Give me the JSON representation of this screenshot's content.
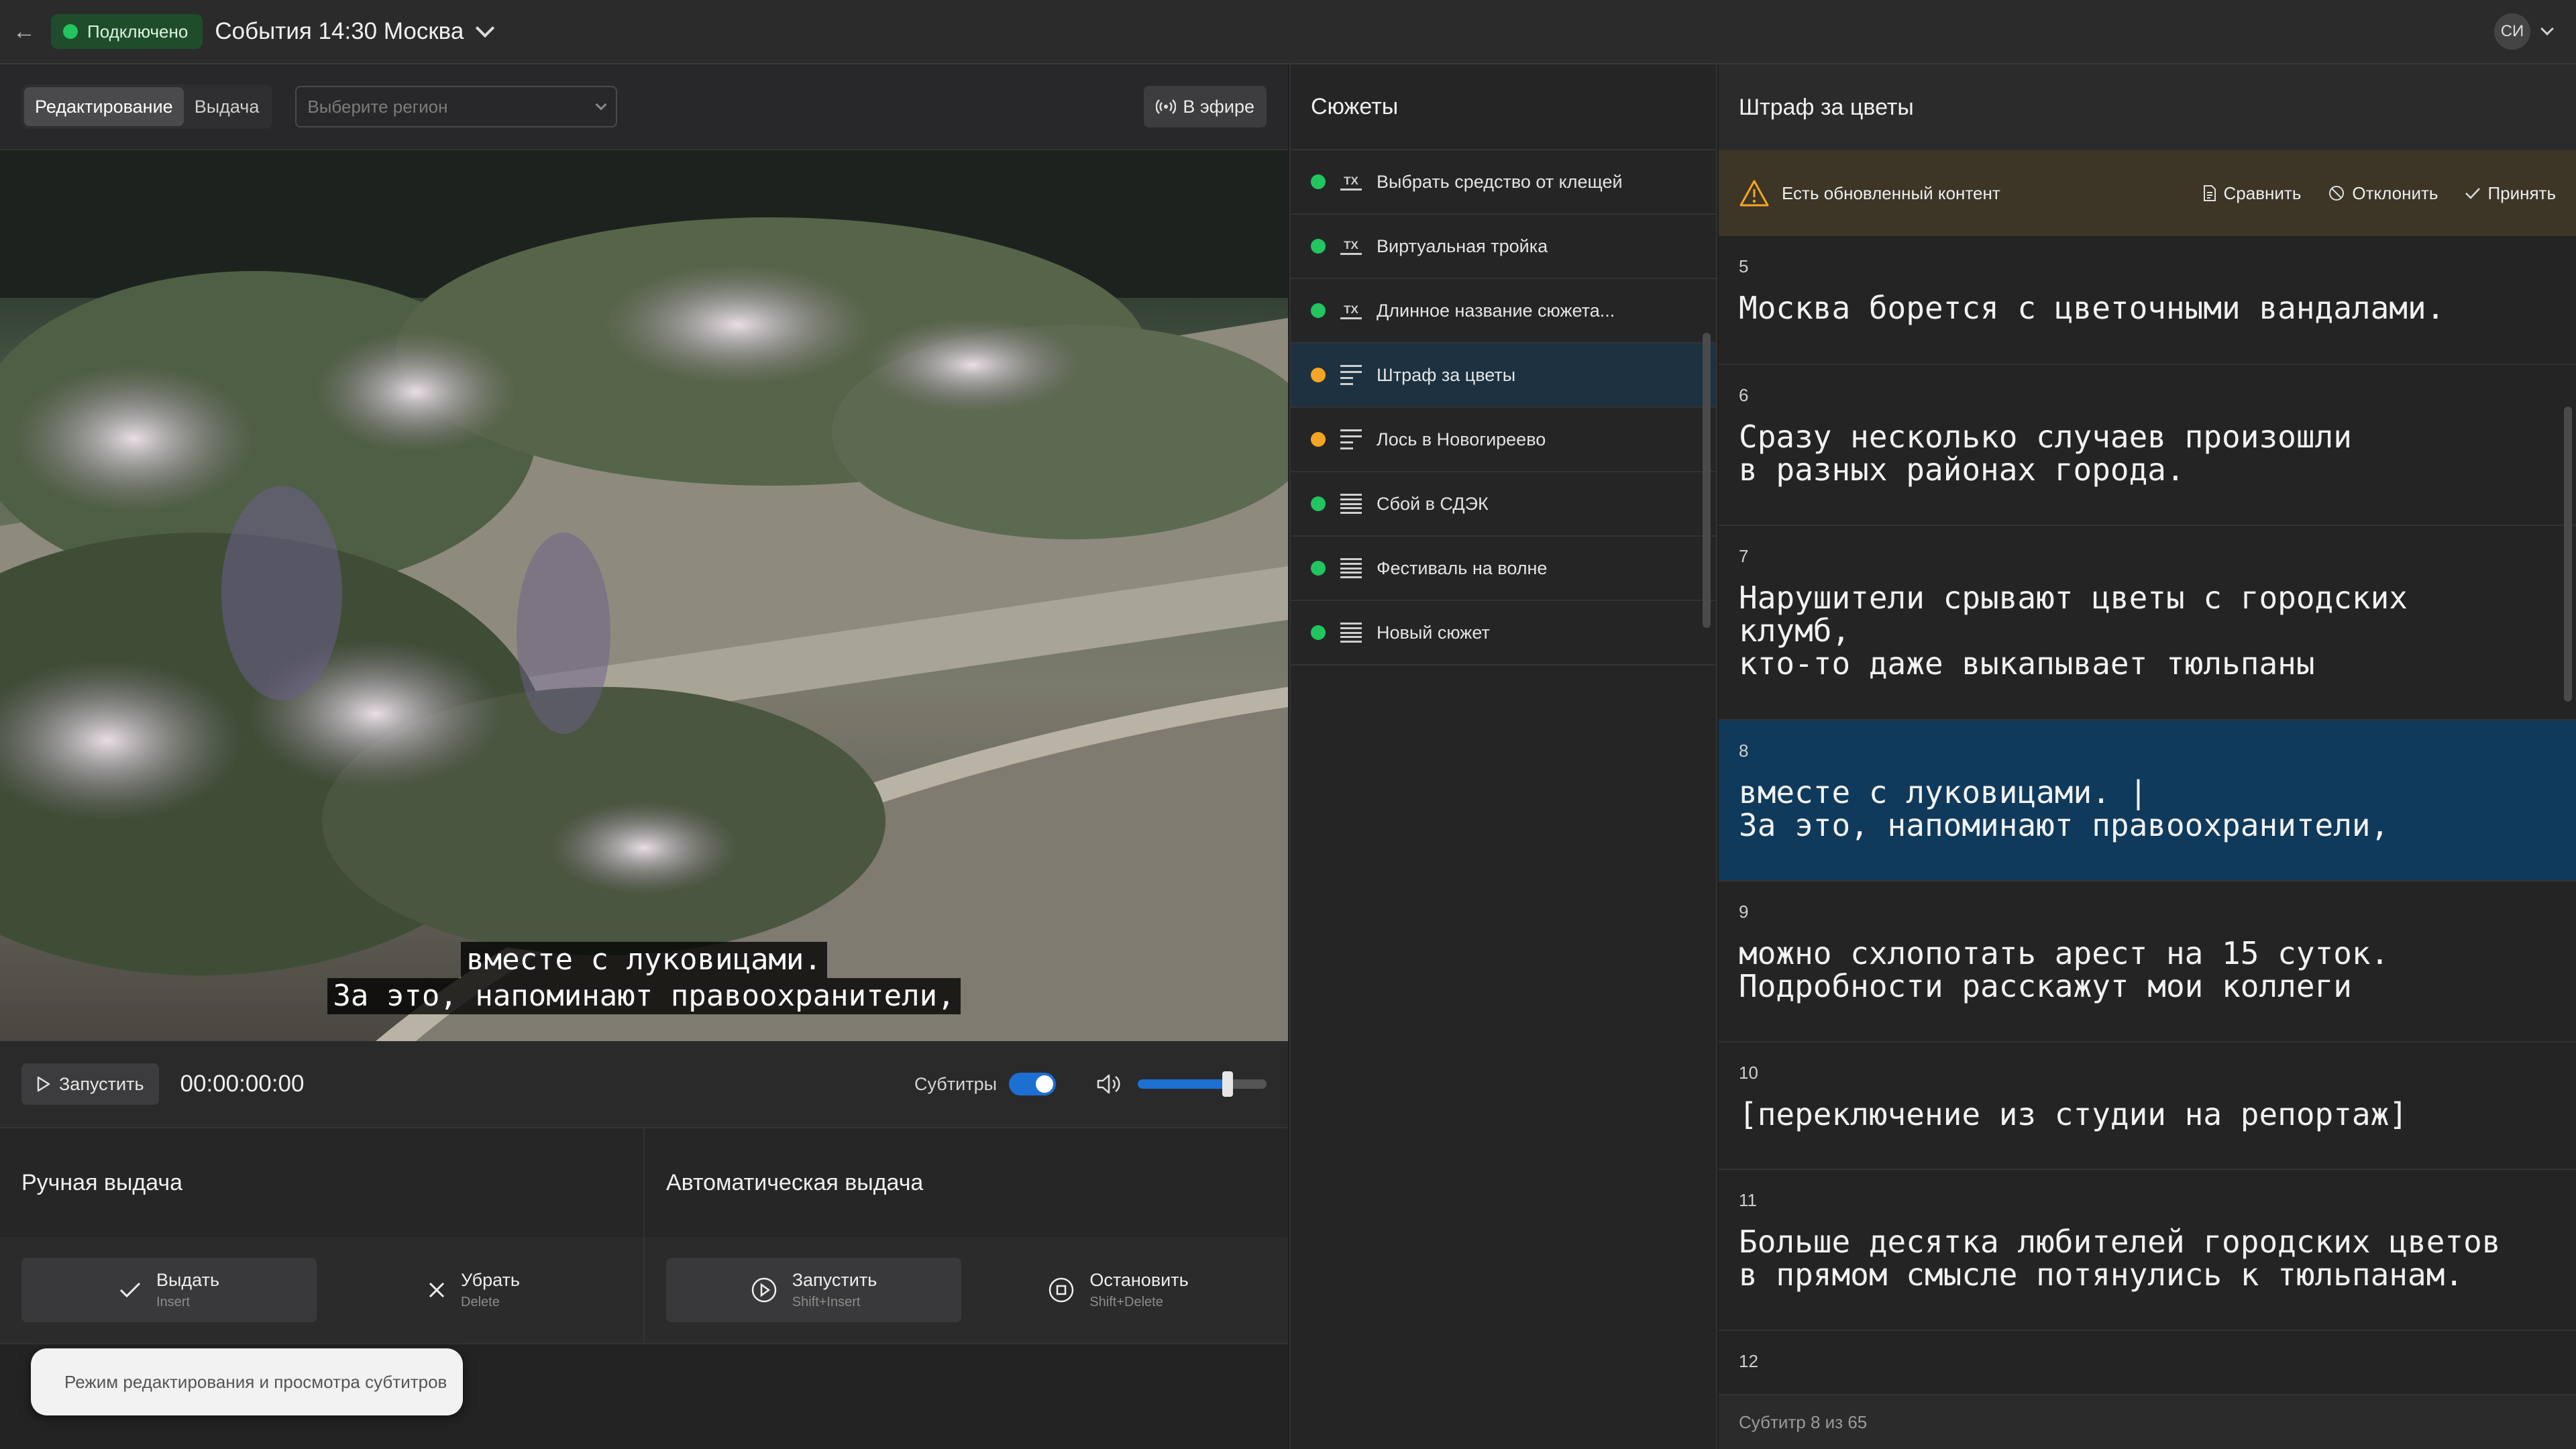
{
  "topbar": {
    "status": "Подключено",
    "title": "События 14:30 Москва",
    "user_initials": "СИ"
  },
  "left": {
    "tabs": [
      "Редактирование",
      "Выдача"
    ],
    "region_placeholder": "Выберите регион",
    "on_air": "В эфире",
    "video_subtitles": [
      "вместе с луковицами.",
      "За это, напоминают правоохранители,"
    ],
    "run_label": "Запустить",
    "timecode": "00:00:00:00",
    "subtitles_label": "Субтитры",
    "subtitles_on": true,
    "volume": 0.7
  },
  "manual": {
    "title": "Ручная выдача",
    "issue": {
      "label": "Выдать",
      "shortcut": "Insert"
    },
    "remove": {
      "label": "Убрать",
      "shortcut": "Delete"
    }
  },
  "auto": {
    "title": "Автоматическая выдача",
    "start": {
      "label": "Запустить",
      "shortcut": "Shift+Insert"
    },
    "stop": {
      "label": "Остановить",
      "shortcut": "Shift+Delete"
    }
  },
  "toast": "Режим редактирования и просмотра субтитров",
  "stories": {
    "title": "Сюжеты",
    "items": [
      {
        "label": "Выбрать средство от клещей",
        "status_color": "#22c55e",
        "icon": "tx-icon"
      },
      {
        "label": "Виртуальная тройка",
        "status_color": "#22c55e",
        "icon": "tx-icon"
      },
      {
        "label": "Длинное название сюжета...",
        "status_color": "#22c55e",
        "icon": "tx-icon"
      },
      {
        "label": "Штраф за цветы",
        "status_color": "#f5a524",
        "icon": "text-edit-icon"
      },
      {
        "label": "Лось в Новогиреево",
        "status_color": "#f5a524",
        "icon": "text-edit-icon"
      },
      {
        "label": "Сбой в СДЭК",
        "status_color": "#22c55e",
        "icon": "text-lines-icon"
      },
      {
        "label": "Фестиваль на волне",
        "status_color": "#22c55e",
        "icon": "text-lines-icon"
      },
      {
        "label": "Новый сюжет",
        "status_color": "#22c55e",
        "icon": "text-lines-icon"
      }
    ]
  },
  "editor": {
    "title": "Штраф за цветы",
    "alert": {
      "text": "Есть обновленный контент",
      "compare": "Сравнить",
      "reject": "Отклонить",
      "accept": "Принять"
    },
    "subs": [
      {
        "num": "5",
        "lines": [
          "Москва борется с цветочными вандалами."
        ]
      },
      {
        "num": "6",
        "lines": [
          "Сразу несколько случаев произошли",
          "в разных районах города."
        ]
      },
      {
        "num": "7",
        "lines": [
          "Нарушители срывают цветы с городских",
          "клумб,",
          "кто-то даже выкапывает тюльпаны"
        ]
      },
      {
        "num": "8",
        "lines": [
          "вместе с луковицами. |",
          "За это, напоминают правоохранители,"
        ]
      },
      {
        "num": "9",
        "lines": [
          "можно схлопотать арест на 15 суток.",
          "Подробности расскажут мои коллеги"
        ]
      },
      {
        "num": "10",
        "lines": [
          "[переключение из студии на репортаж]"
        ]
      },
      {
        "num": "11",
        "lines": [
          "Больше десятка любителей городских цветов",
          "в прямом смысле потянулись к тюльпанам."
        ]
      },
      {
        "num": "12",
        "lines": [
          ""
        ]
      }
    ],
    "footer": "Субтитр 8 из 65"
  }
}
